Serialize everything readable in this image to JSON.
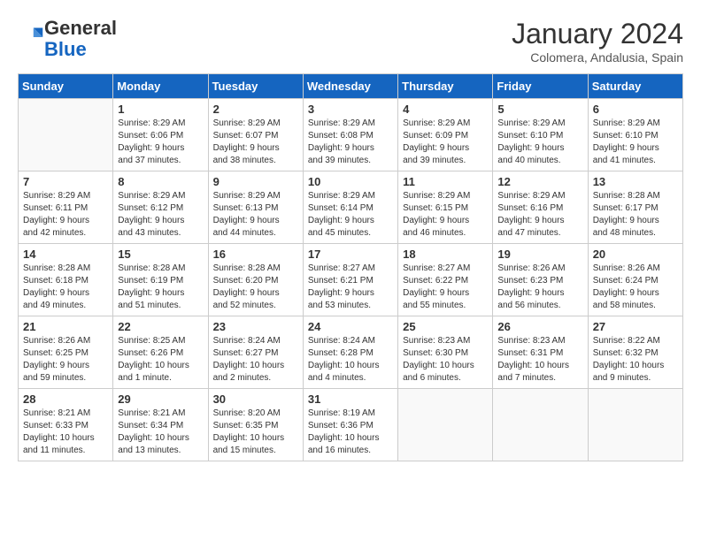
{
  "header": {
    "logo_general": "General",
    "logo_blue": "Blue",
    "month_title": "January 2024",
    "subtitle": "Colomera, Andalusia, Spain"
  },
  "columns": [
    "Sunday",
    "Monday",
    "Tuesday",
    "Wednesday",
    "Thursday",
    "Friday",
    "Saturday"
  ],
  "weeks": [
    [
      {
        "day": "",
        "info": ""
      },
      {
        "day": "1",
        "info": "Sunrise: 8:29 AM\nSunset: 6:06 PM\nDaylight: 9 hours\nand 37 minutes."
      },
      {
        "day": "2",
        "info": "Sunrise: 8:29 AM\nSunset: 6:07 PM\nDaylight: 9 hours\nand 38 minutes."
      },
      {
        "day": "3",
        "info": "Sunrise: 8:29 AM\nSunset: 6:08 PM\nDaylight: 9 hours\nand 39 minutes."
      },
      {
        "day": "4",
        "info": "Sunrise: 8:29 AM\nSunset: 6:09 PM\nDaylight: 9 hours\nand 39 minutes."
      },
      {
        "day": "5",
        "info": "Sunrise: 8:29 AM\nSunset: 6:10 PM\nDaylight: 9 hours\nand 40 minutes."
      },
      {
        "day": "6",
        "info": "Sunrise: 8:29 AM\nSunset: 6:10 PM\nDaylight: 9 hours\nand 41 minutes."
      }
    ],
    [
      {
        "day": "7",
        "info": "Sunrise: 8:29 AM\nSunset: 6:11 PM\nDaylight: 9 hours\nand 42 minutes."
      },
      {
        "day": "8",
        "info": "Sunrise: 8:29 AM\nSunset: 6:12 PM\nDaylight: 9 hours\nand 43 minutes."
      },
      {
        "day": "9",
        "info": "Sunrise: 8:29 AM\nSunset: 6:13 PM\nDaylight: 9 hours\nand 44 minutes."
      },
      {
        "day": "10",
        "info": "Sunrise: 8:29 AM\nSunset: 6:14 PM\nDaylight: 9 hours\nand 45 minutes."
      },
      {
        "day": "11",
        "info": "Sunrise: 8:29 AM\nSunset: 6:15 PM\nDaylight: 9 hours\nand 46 minutes."
      },
      {
        "day": "12",
        "info": "Sunrise: 8:29 AM\nSunset: 6:16 PM\nDaylight: 9 hours\nand 47 minutes."
      },
      {
        "day": "13",
        "info": "Sunrise: 8:28 AM\nSunset: 6:17 PM\nDaylight: 9 hours\nand 48 minutes."
      }
    ],
    [
      {
        "day": "14",
        "info": "Sunrise: 8:28 AM\nSunset: 6:18 PM\nDaylight: 9 hours\nand 49 minutes."
      },
      {
        "day": "15",
        "info": "Sunrise: 8:28 AM\nSunset: 6:19 PM\nDaylight: 9 hours\nand 51 minutes."
      },
      {
        "day": "16",
        "info": "Sunrise: 8:28 AM\nSunset: 6:20 PM\nDaylight: 9 hours\nand 52 minutes."
      },
      {
        "day": "17",
        "info": "Sunrise: 8:27 AM\nSunset: 6:21 PM\nDaylight: 9 hours\nand 53 minutes."
      },
      {
        "day": "18",
        "info": "Sunrise: 8:27 AM\nSunset: 6:22 PM\nDaylight: 9 hours\nand 55 minutes."
      },
      {
        "day": "19",
        "info": "Sunrise: 8:26 AM\nSunset: 6:23 PM\nDaylight: 9 hours\nand 56 minutes."
      },
      {
        "day": "20",
        "info": "Sunrise: 8:26 AM\nSunset: 6:24 PM\nDaylight: 9 hours\nand 58 minutes."
      }
    ],
    [
      {
        "day": "21",
        "info": "Sunrise: 8:26 AM\nSunset: 6:25 PM\nDaylight: 9 hours\nand 59 minutes."
      },
      {
        "day": "22",
        "info": "Sunrise: 8:25 AM\nSunset: 6:26 PM\nDaylight: 10 hours\nand 1 minute."
      },
      {
        "day": "23",
        "info": "Sunrise: 8:24 AM\nSunset: 6:27 PM\nDaylight: 10 hours\nand 2 minutes."
      },
      {
        "day": "24",
        "info": "Sunrise: 8:24 AM\nSunset: 6:28 PM\nDaylight: 10 hours\nand 4 minutes."
      },
      {
        "day": "25",
        "info": "Sunrise: 8:23 AM\nSunset: 6:30 PM\nDaylight: 10 hours\nand 6 minutes."
      },
      {
        "day": "26",
        "info": "Sunrise: 8:23 AM\nSunset: 6:31 PM\nDaylight: 10 hours\nand 7 minutes."
      },
      {
        "day": "27",
        "info": "Sunrise: 8:22 AM\nSunset: 6:32 PM\nDaylight: 10 hours\nand 9 minutes."
      }
    ],
    [
      {
        "day": "28",
        "info": "Sunrise: 8:21 AM\nSunset: 6:33 PM\nDaylight: 10 hours\nand 11 minutes."
      },
      {
        "day": "29",
        "info": "Sunrise: 8:21 AM\nSunset: 6:34 PM\nDaylight: 10 hours\nand 13 minutes."
      },
      {
        "day": "30",
        "info": "Sunrise: 8:20 AM\nSunset: 6:35 PM\nDaylight: 10 hours\nand 15 minutes."
      },
      {
        "day": "31",
        "info": "Sunrise: 8:19 AM\nSunset: 6:36 PM\nDaylight: 10 hours\nand 16 minutes."
      },
      {
        "day": "",
        "info": ""
      },
      {
        "day": "",
        "info": ""
      },
      {
        "day": "",
        "info": ""
      }
    ]
  ]
}
